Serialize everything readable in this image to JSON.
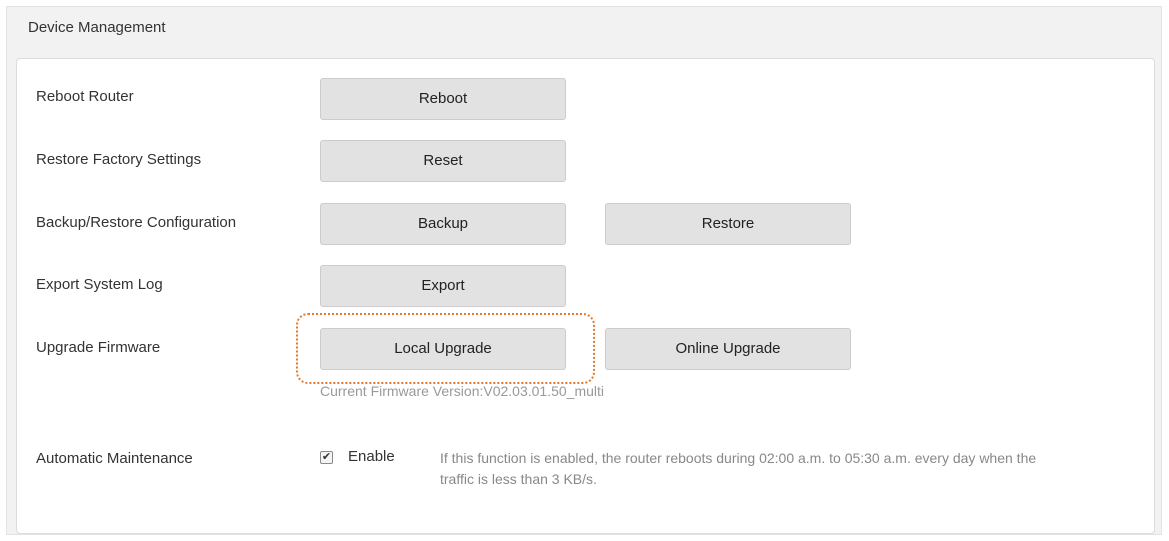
{
  "section": {
    "title": "Device Management"
  },
  "rows": {
    "reboot": {
      "label": "Reboot Router",
      "button": "Reboot"
    },
    "restore_factory": {
      "label": "Restore Factory Settings",
      "button": "Reset"
    },
    "backup_restore": {
      "label": "Backup/Restore Configuration",
      "backup_button": "Backup",
      "restore_button": "Restore"
    },
    "export_log": {
      "label": "Export System Log",
      "button": "Export"
    },
    "upgrade": {
      "label": "Upgrade Firmware",
      "local_button": "Local Upgrade",
      "online_button": "Online Upgrade",
      "current_version": "Current Firmware Version:V02.03.01.50_multi"
    },
    "maintenance": {
      "label": "Automatic Maintenance",
      "enable_checked": true,
      "enable_label": "Enable",
      "checkmark": "✔",
      "description": "If this function is enabled, the router reboots during 02:00 a.m. to 05:30 a.m. every day when the traffic is less than 3 KB/s."
    }
  },
  "colors": {
    "button_bg": "#e2e2e2",
    "highlight_outline": "#e07a2e",
    "muted_text": "#999999"
  }
}
